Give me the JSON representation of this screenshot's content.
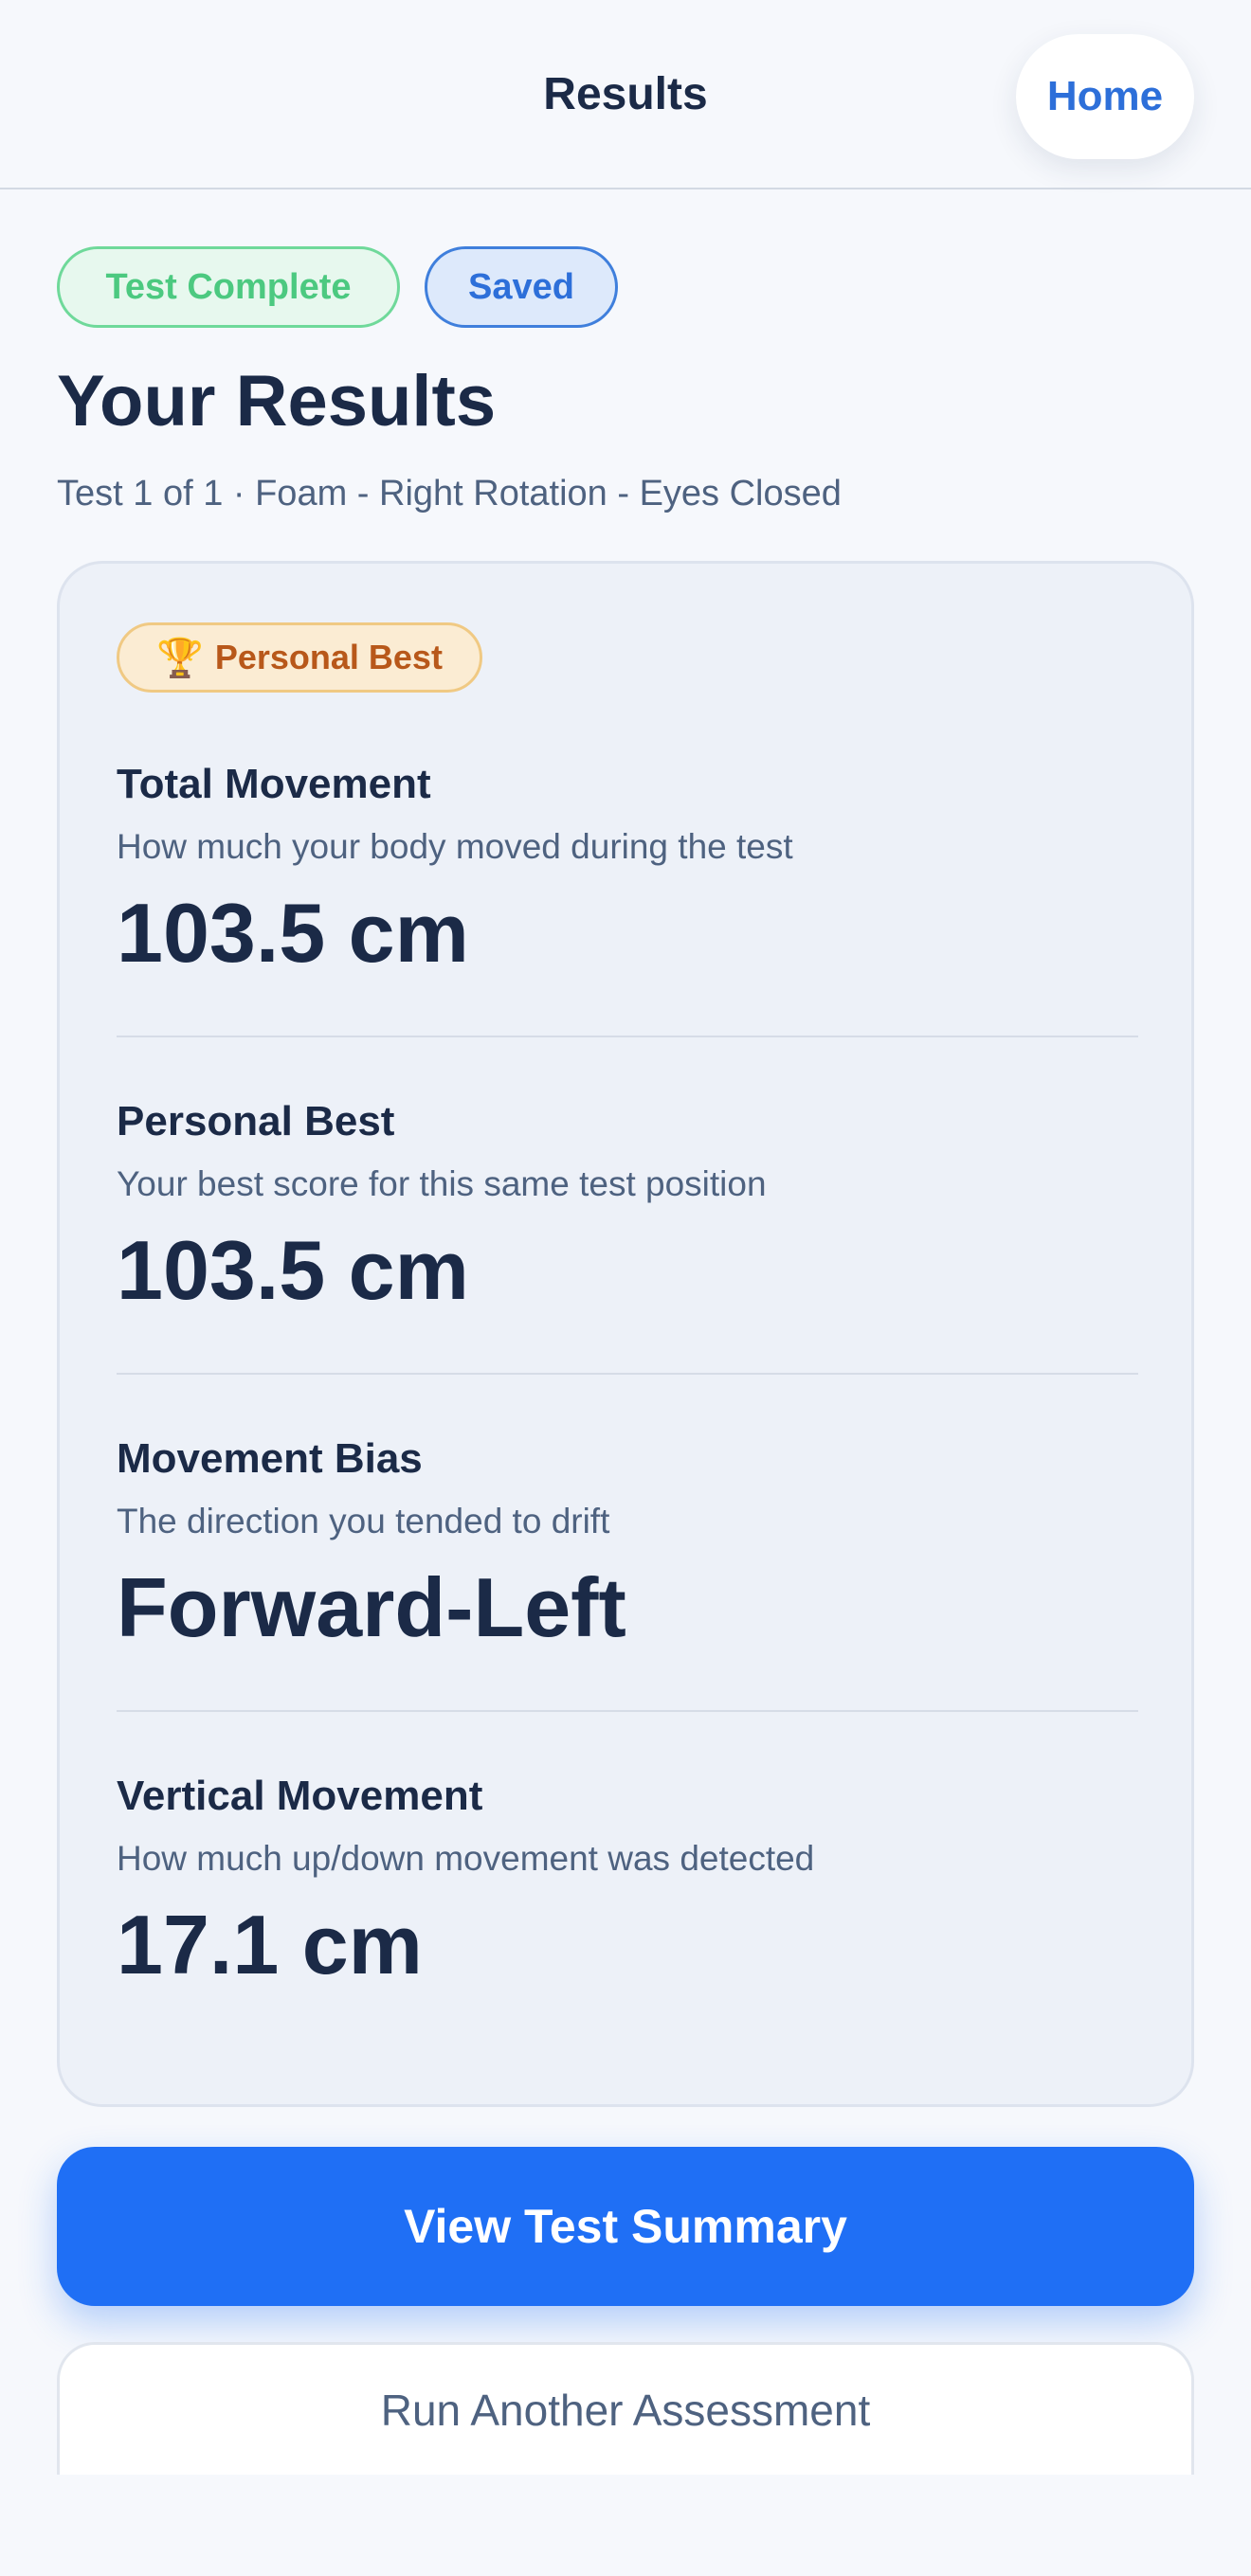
{
  "header": {
    "title": "Results",
    "home_label": "Home"
  },
  "status": {
    "complete_label": "Test Complete",
    "saved_label": "Saved"
  },
  "main": {
    "title": "Your Results",
    "subtitle": "Test 1 of 1 · Foam - Right Rotation - Eyes Closed"
  },
  "card": {
    "badge_label": "Personal Best",
    "badge_icon": "🏆",
    "metrics": [
      {
        "label": "Total Movement",
        "description": "How much your body moved during the test",
        "value": "103.5 cm"
      },
      {
        "label": "Personal Best",
        "description": "Your best score for this same test position",
        "value": "103.5 cm"
      },
      {
        "label": "Movement Bias",
        "description": "The direction you tended to drift",
        "value": "Forward-Left"
      },
      {
        "label": "Vertical Movement",
        "description": "How much up/down movement was detected",
        "value": "17.1 cm"
      }
    ]
  },
  "actions": {
    "primary_label": "View Test Summary",
    "secondary_label": "Run Another Assessment"
  },
  "colors": {
    "accent": "#1f6ff5",
    "success": "#4cc980",
    "badge_text": "#b8581a",
    "text_primary": "#1b2a47"
  }
}
